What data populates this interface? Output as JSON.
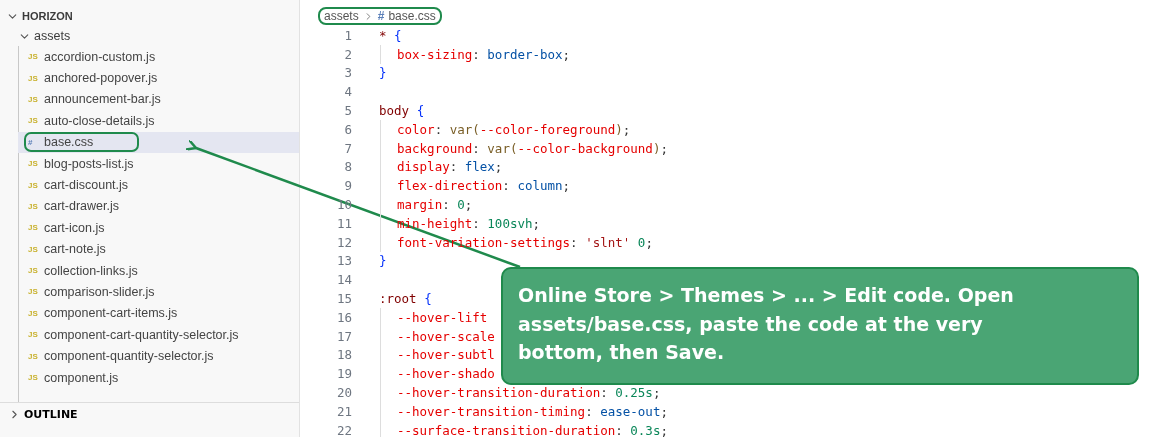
{
  "explorer": {
    "root": {
      "label": "HORIZON",
      "expanded": true
    },
    "folder": {
      "label": "assets",
      "expanded": true
    },
    "files": [
      {
        "badge": "JS",
        "kind": "js",
        "name": "accordion-custom.js",
        "selected": false,
        "circled": false
      },
      {
        "badge": "JS",
        "kind": "js",
        "name": "anchored-popover.js",
        "selected": false,
        "circled": false
      },
      {
        "badge": "JS",
        "kind": "js",
        "name": "announcement-bar.js",
        "selected": false,
        "circled": false
      },
      {
        "badge": "JS",
        "kind": "js",
        "name": "auto-close-details.js",
        "selected": false,
        "circled": false
      },
      {
        "badge": "#",
        "kind": "css",
        "name": "base.css",
        "selected": true,
        "circled": true
      },
      {
        "badge": "JS",
        "kind": "js",
        "name": "blog-posts-list.js",
        "selected": false,
        "circled": false
      },
      {
        "badge": "JS",
        "kind": "js",
        "name": "cart-discount.js",
        "selected": false,
        "circled": false
      },
      {
        "badge": "JS",
        "kind": "js",
        "name": "cart-drawer.js",
        "selected": false,
        "circled": false
      },
      {
        "badge": "JS",
        "kind": "js",
        "name": "cart-icon.js",
        "selected": false,
        "circled": false
      },
      {
        "badge": "JS",
        "kind": "js",
        "name": "cart-note.js",
        "selected": false,
        "circled": false
      },
      {
        "badge": "JS",
        "kind": "js",
        "name": "collection-links.js",
        "selected": false,
        "circled": false
      },
      {
        "badge": "JS",
        "kind": "js",
        "name": "comparison-slider.js",
        "selected": false,
        "circled": false
      },
      {
        "badge": "JS",
        "kind": "js",
        "name": "component-cart-items.js",
        "selected": false,
        "circled": false
      },
      {
        "badge": "JS",
        "kind": "js",
        "name": "component-cart-quantity-selector.js",
        "selected": false,
        "circled": false
      },
      {
        "badge": "JS",
        "kind": "js",
        "name": "component-quantity-selector.js",
        "selected": false,
        "circled": false
      },
      {
        "badge": "JS",
        "kind": "js",
        "name": "component.js",
        "selected": false,
        "circled": false
      }
    ],
    "outline": {
      "label": "OUTLINE",
      "expanded": false
    }
  },
  "editor": {
    "breadcrumb": {
      "circled": true,
      "folder": "assets",
      "file_badge": "#",
      "file": "base.css"
    },
    "lines": [
      {
        "number": "1",
        "indented": false,
        "tokens": [
          {
            "kind": "selector",
            "text": "* "
          },
          {
            "kind": "brace",
            "text": "{"
          }
        ]
      },
      {
        "number": "2",
        "indented": true,
        "tokens": [
          {
            "kind": "property",
            "text": "box-sizing"
          },
          {
            "kind": "punct",
            "text": ": "
          },
          {
            "kind": "value",
            "text": "border-box"
          },
          {
            "kind": "punct",
            "text": ";"
          }
        ]
      },
      {
        "number": "3",
        "indented": false,
        "tokens": [
          {
            "kind": "brace",
            "text": "}"
          }
        ]
      },
      {
        "number": "4",
        "indented": false
      },
      {
        "number": "5",
        "indented": false,
        "tokens": [
          {
            "kind": "selector",
            "text": "body "
          },
          {
            "kind": "brace",
            "text": "{"
          }
        ]
      },
      {
        "number": "6",
        "indented": true,
        "tokens": [
          {
            "kind": "property",
            "text": "color"
          },
          {
            "kind": "punct",
            "text": ": "
          },
          {
            "kind": "function",
            "text": "var("
          },
          {
            "kind": "property",
            "text": "--color-foreground"
          },
          {
            "kind": "function",
            "text": ")"
          },
          {
            "kind": "punct",
            "text": ";"
          }
        ]
      },
      {
        "number": "7",
        "indented": true,
        "tokens": [
          {
            "kind": "property",
            "text": "background"
          },
          {
            "kind": "punct",
            "text": ": "
          },
          {
            "kind": "function",
            "text": "var("
          },
          {
            "kind": "property",
            "text": "--color-background"
          },
          {
            "kind": "function",
            "text": ")"
          },
          {
            "kind": "punct",
            "text": ";"
          }
        ]
      },
      {
        "number": "8",
        "indented": true,
        "tokens": [
          {
            "kind": "property",
            "text": "display"
          },
          {
            "kind": "punct",
            "text": ": "
          },
          {
            "kind": "value",
            "text": "flex"
          },
          {
            "kind": "punct",
            "text": ";"
          }
        ]
      },
      {
        "number": "9",
        "indented": true,
        "tokens": [
          {
            "kind": "property",
            "text": "flex-direction"
          },
          {
            "kind": "punct",
            "text": ": "
          },
          {
            "kind": "value",
            "text": "column"
          },
          {
            "kind": "punct",
            "text": ";"
          }
        ]
      },
      {
        "number": "10",
        "indented": true,
        "tokens": [
          {
            "kind": "property",
            "text": "margin"
          },
          {
            "kind": "punct",
            "text": ": "
          },
          {
            "kind": "number",
            "text": "0"
          },
          {
            "kind": "punct",
            "text": ";"
          }
        ]
      },
      {
        "number": "11",
        "indented": true,
        "tokens": [
          {
            "kind": "property",
            "text": "min-height"
          },
          {
            "kind": "punct",
            "text": ": "
          },
          {
            "kind": "number",
            "text": "100svh"
          },
          {
            "kind": "punct",
            "text": ";"
          }
        ]
      },
      {
        "number": "12",
        "indented": true,
        "tokens": [
          {
            "kind": "property",
            "text": "font-variation-settings"
          },
          {
            "kind": "punct",
            "text": ": "
          },
          {
            "kind": "string",
            "text": "'slnt'"
          },
          {
            "kind": "number",
            "text": " 0"
          },
          {
            "kind": "punct",
            "text": ";"
          }
        ]
      },
      {
        "number": "13",
        "indented": false,
        "tokens": [
          {
            "kind": "brace",
            "text": "}"
          }
        ]
      },
      {
        "number": "14",
        "indented": false
      },
      {
        "number": "15",
        "indented": false,
        "tokens": [
          {
            "kind": "selector",
            "text": ":root "
          },
          {
            "kind": "brace",
            "text": "{"
          }
        ]
      },
      {
        "number": "16",
        "indented": true,
        "tokens": [
          {
            "kind": "property",
            "text": "--hover-lift"
          }
        ]
      },
      {
        "number": "17",
        "indented": true,
        "tokens": [
          {
            "kind": "property",
            "text": "--hover-scale"
          }
        ]
      },
      {
        "number": "18",
        "indented": true,
        "tokens": [
          {
            "kind": "property",
            "text": "--hover-subtl"
          }
        ]
      },
      {
        "number": "19",
        "indented": true,
        "tokens": [
          {
            "kind": "property",
            "text": "--hover-shado"
          }
        ]
      },
      {
        "number": "20",
        "indented": true,
        "tokens": [
          {
            "kind": "property",
            "text": "--hover-transition-duration"
          },
          {
            "kind": "punct",
            "text": ": "
          },
          {
            "kind": "number",
            "text": "0.25s"
          },
          {
            "kind": "punct",
            "text": ";"
          }
        ]
      },
      {
        "number": "21",
        "indented": true,
        "tokens": [
          {
            "kind": "property",
            "text": "--hover-transition-timing"
          },
          {
            "kind": "punct",
            "text": ": "
          },
          {
            "kind": "value",
            "text": "ease-out"
          },
          {
            "kind": "punct",
            "text": ";"
          }
        ]
      },
      {
        "number": "22",
        "indented": true,
        "tokens": [
          {
            "kind": "property",
            "text": "--surface-transition-duration"
          },
          {
            "kind": "punct",
            "text": ": "
          },
          {
            "kind": "number",
            "text": "0.3s"
          },
          {
            "kind": "punct",
            "text": ";"
          }
        ]
      }
    ]
  },
  "callout": {
    "text": "Online Store > Themes > ... > Edit code. Open assets/base.css, paste the code at the very bottom, then Save."
  }
}
